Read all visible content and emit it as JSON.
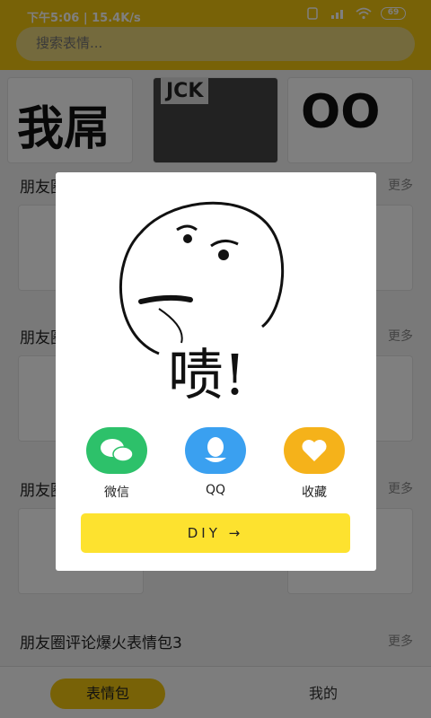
{
  "status_bar": {
    "time": "下午5:06 | 15.4K/s",
    "battery": "69"
  },
  "search": {
    "placeholder": "搜索表情..."
  },
  "background": {
    "tiles_row1": [
      "我屌",
      "JCK",
      "OO"
    ],
    "sections": [
      {
        "title": "朋友圈",
        "more": "更多"
      },
      {
        "title": "朋友圈",
        "more": "更多"
      },
      {
        "title": "朋友圈",
        "more": "更多"
      },
      {
        "title": "朋友圈评论爆火表情包3",
        "more": "更多"
      }
    ]
  },
  "dialog": {
    "sticker_text": "啧!",
    "share": [
      {
        "label": "微信",
        "color": "#2dc16a",
        "icon": "wechat-icon"
      },
      {
        "label": "QQ",
        "color": "#3aa0f0",
        "icon": "qq-icon"
      },
      {
        "label": "收藏",
        "color": "#f5b21a",
        "icon": "heart-icon"
      }
    ],
    "diy_label": "DIY →"
  },
  "bottom_nav": {
    "tab1": "表情包",
    "tab2": "我的"
  },
  "colors": {
    "accent": "#f1c40f",
    "diy_button": "#fde22f"
  }
}
